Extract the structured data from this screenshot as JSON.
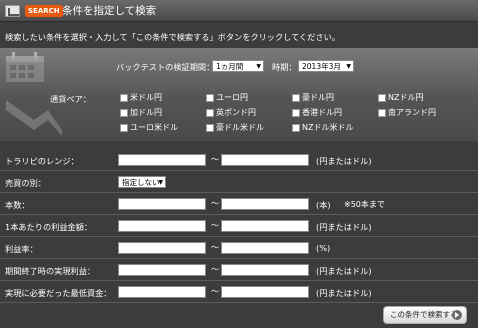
{
  "header": {
    "badge": "SEARCH",
    "title": "条件を指定して検索"
  },
  "intro": "検索したい条件を選択・入力して「この条件で検索する」ボタンをクリックしてください。",
  "backtest": {
    "period_label": "バックテストの検証期間：",
    "period_value": "1ヵ月間",
    "time_label": "時期：",
    "time_value": "2013年3月"
  },
  "pairs": {
    "label": "通貨ペア：",
    "items": [
      "米ドル円",
      "ユーロ円",
      "豪ドル円",
      "NZドル円",
      "加ドル円",
      "英ポンド円",
      "香港ドル円",
      "南アランド円",
      "ユーロ米ドル",
      "豪ドル米ドル",
      "NZドル米ドル"
    ]
  },
  "fields": [
    {
      "label": "トラリピのレンジ：",
      "unit": "(円またはドル)"
    },
    {
      "label": "売買の別：",
      "select": "指定しない"
    },
    {
      "label": "本数：",
      "unit": "(本)",
      "note": "※50本まで"
    },
    {
      "label": "1本あたりの利益金額：",
      "unit": "(円またはドル)"
    },
    {
      "label": "利益率：",
      "unit": "(%)"
    },
    {
      "label": "期間終了時の実現利益：",
      "unit": "(円またはドル)"
    },
    {
      "label": "実現に必要だった最低資金：",
      "unit": "(円またはドル)"
    }
  ],
  "tilde": "～",
  "search_button": "この条件で検索する",
  "icons": [
    "calendar-icon",
    "arrow-icon",
    "go-arrow-icon"
  ]
}
